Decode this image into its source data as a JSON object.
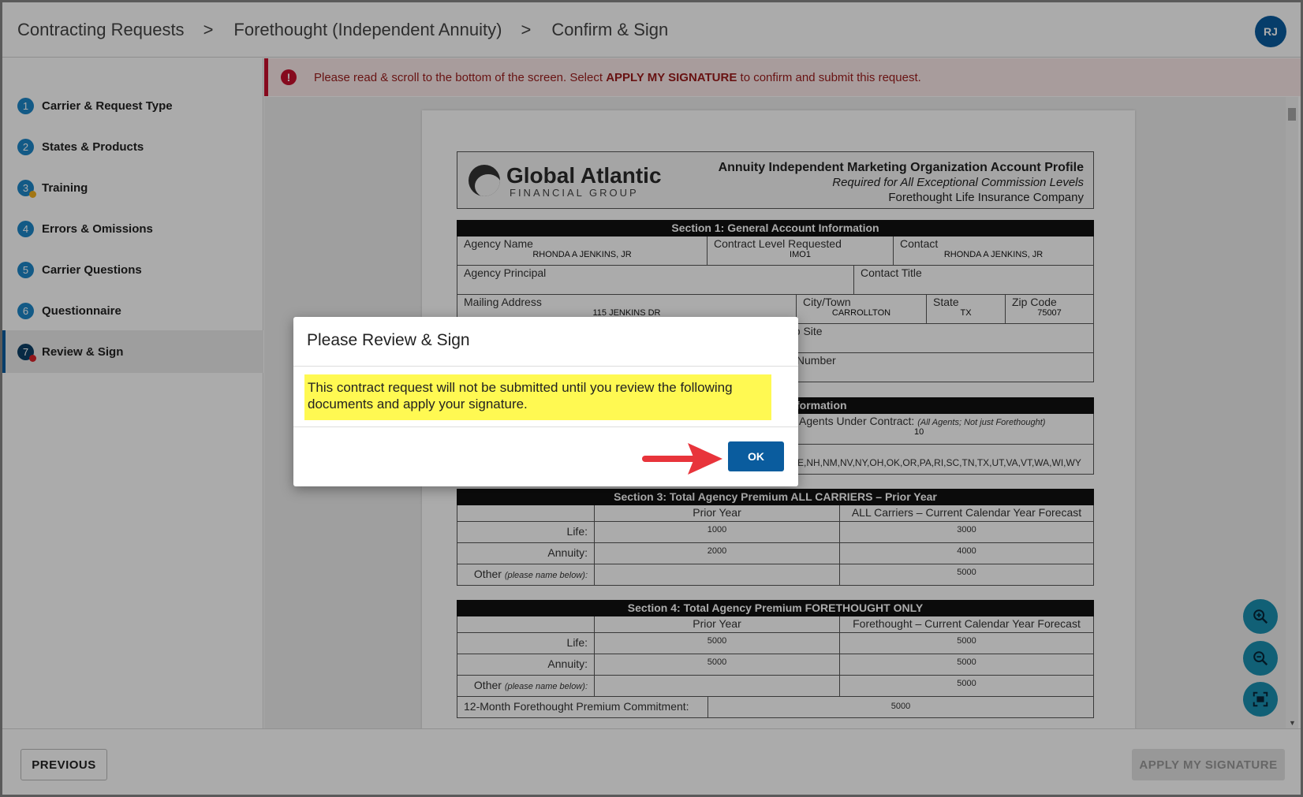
{
  "breadcrumb": [
    "Contracting Requests",
    "Forethought (Independent Annuity)",
    "Confirm & Sign"
  ],
  "breadcrumb_sep": ">",
  "user": {
    "initials": "RJ"
  },
  "steps": [
    {
      "num": "1",
      "label": "Carrier & Request Type"
    },
    {
      "num": "2",
      "label": "States & Products"
    },
    {
      "num": "3",
      "label": "Training"
    },
    {
      "num": "4",
      "label": "Errors & Omissions"
    },
    {
      "num": "5",
      "label": "Carrier Questions"
    },
    {
      "num": "6",
      "label": "Questionnaire"
    },
    {
      "num": "7",
      "label": "Review & Sign"
    }
  ],
  "alert": {
    "prefix": "Please read & scroll to the bottom of the screen. Select ",
    "strong": "APPLY MY SIGNATURE",
    "suffix": " to confirm and submit this request."
  },
  "doc": {
    "logo_name": "Global Atlantic",
    "logo_sub": "FINANCIAL GROUP",
    "title": "Annuity Independent Marketing Organization Account Profile",
    "subtitle": "Required for All Exceptional Commission Levels",
    "company": "Forethought Life Insurance Company",
    "section1": {
      "heading": "Section 1: General Account Information",
      "agency_name_label": "Agency Name",
      "agency_name": "RHONDA A JENKINS, JR",
      "contract_level_label": "Contract Level Requested",
      "contract_level": "IMO1",
      "contact_label": "Contact",
      "contact": "RHONDA A JENKINS, JR",
      "principal_label": "Agency Principal",
      "contact_title_label": "Contact Title",
      "mailing_label": "Mailing Address",
      "mailing": "115 JENKINS DR",
      "city_label": "City/Town",
      "city": "CARROLLTON",
      "state_label": "State",
      "state": "TX",
      "zip_label": "Zip Code",
      "zip": "75007",
      "website_partial": "eb Site",
      "fax_partial": "x Number"
    },
    "section2": {
      "heading_partial": "formation",
      "agents_label": "al Agents Under Contract:",
      "agents_note": "(All Agents; Not just Forethought)",
      "agents_value": "10",
      "states_partial": ",NE,NH,NM,NV,NY,OH,OK,OR,PA,RI,SC,TN,TX,UT,VA,VT,WA,WI,WY"
    },
    "section3": {
      "heading": "Section 3: Total Agency Premium ALL CARRIERS – Prior Year",
      "col1": "Prior Year",
      "col2": "ALL Carriers – Current Calendar Year Forecast",
      "rows": [
        {
          "label": "Life:",
          "prior": "1000",
          "forecast": "3000"
        },
        {
          "label": "Annuity:",
          "prior": "2000",
          "forecast": "4000"
        },
        {
          "label": "Other",
          "note": "(please name below):",
          "prior": "",
          "forecast": "5000"
        }
      ]
    },
    "section4": {
      "heading": "Section 4: Total Agency Premium FORETHOUGHT ONLY",
      "col1": "Prior Year",
      "col2": "Forethought – Current Calendar Year Forecast",
      "rows": [
        {
          "label": "Life:",
          "prior": "5000",
          "forecast": "5000"
        },
        {
          "label": "Annuity:",
          "prior": "5000",
          "forecast": "5000"
        },
        {
          "label": "Other",
          "note": "(please name below):",
          "prior": "",
          "forecast": "5000"
        }
      ],
      "commitment_label": "12-Month Forethought Premium Commitment:",
      "commitment_value": "5000"
    }
  },
  "dialog": {
    "title": "Please Review & Sign",
    "body": "This contract request will not be submitted until you review the following documents and apply your signature.",
    "ok": "OK"
  },
  "footer": {
    "previous": "PREVIOUS",
    "apply": "APPLY MY SIGNATURE"
  },
  "fabs": [
    "zoom-in-icon",
    "zoom-out-icon",
    "fit-screen-icon"
  ],
  "colors": {
    "accent": "#0a5c9e",
    "alert_red": "#c8102e",
    "highlight": "#fff952",
    "fab": "#1a8fb0"
  }
}
